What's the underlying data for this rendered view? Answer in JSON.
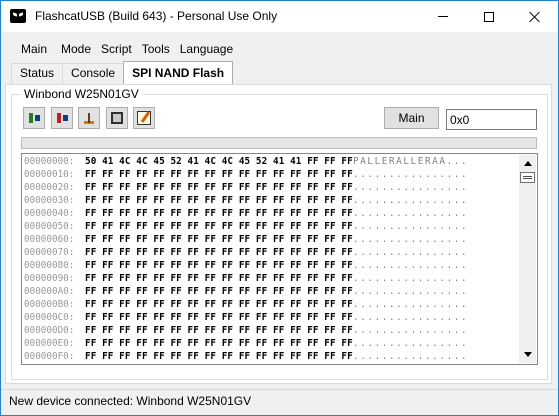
{
  "window": {
    "title": "FlashcatUSB (Build 643) - Personal Use Only",
    "accent": "#1883d7"
  },
  "menubar": {
    "items": [
      "Main",
      "Mode",
      "Script",
      "Tools",
      "Language"
    ]
  },
  "tabs": [
    {
      "label": "Status",
      "active": false
    },
    {
      "label": "Console",
      "active": false
    },
    {
      "label": "SPI NAND Flash",
      "active": true
    }
  ],
  "device": {
    "group_label": "Winbond W25N01GV",
    "toolbar_icons": [
      "read-flash-icon",
      "write-flash-icon",
      "erase-flash-icon",
      "chip-icon",
      "edit-icon"
    ],
    "main_button": "Main",
    "address_value": "0x0"
  },
  "hex": {
    "rows": [
      {
        "addr": "00000000:",
        "bytes": "50 41 4C 4C 45 52 41 4C 4C 45 52 41 41 FF FF FF",
        "ascii": "PALLERALLERAA..."
      },
      {
        "addr": "00000010:",
        "bytes": "FF FF FF FF FF FF FF FF FF FF FF FF FF FF FF FF",
        "ascii": "................"
      },
      {
        "addr": "00000020:",
        "bytes": "FF FF FF FF FF FF FF FF FF FF FF FF FF FF FF FF",
        "ascii": "................"
      },
      {
        "addr": "00000030:",
        "bytes": "FF FF FF FF FF FF FF FF FF FF FF FF FF FF FF FF",
        "ascii": "................"
      },
      {
        "addr": "00000040:",
        "bytes": "FF FF FF FF FF FF FF FF FF FF FF FF FF FF FF FF",
        "ascii": "................"
      },
      {
        "addr": "00000050:",
        "bytes": "FF FF FF FF FF FF FF FF FF FF FF FF FF FF FF FF",
        "ascii": "................"
      },
      {
        "addr": "00000060:",
        "bytes": "FF FF FF FF FF FF FF FF FF FF FF FF FF FF FF FF",
        "ascii": "................"
      },
      {
        "addr": "00000070:",
        "bytes": "FF FF FF FF FF FF FF FF FF FF FF FF FF FF FF FF",
        "ascii": "................"
      },
      {
        "addr": "00000080:",
        "bytes": "FF FF FF FF FF FF FF FF FF FF FF FF FF FF FF FF",
        "ascii": "................"
      },
      {
        "addr": "00000090:",
        "bytes": "FF FF FF FF FF FF FF FF FF FF FF FF FF FF FF FF",
        "ascii": "................"
      },
      {
        "addr": "000000A0:",
        "bytes": "FF FF FF FF FF FF FF FF FF FF FF FF FF FF FF FF",
        "ascii": "................"
      },
      {
        "addr": "000000B0:",
        "bytes": "FF FF FF FF FF FF FF FF FF FF FF FF FF FF FF FF",
        "ascii": "................"
      },
      {
        "addr": "000000C0:",
        "bytes": "FF FF FF FF FF FF FF FF FF FF FF FF FF FF FF FF",
        "ascii": "................"
      },
      {
        "addr": "000000D0:",
        "bytes": "FF FF FF FF FF FF FF FF FF FF FF FF FF FF FF FF",
        "ascii": "................"
      },
      {
        "addr": "000000E0:",
        "bytes": "FF FF FF FF FF FF FF FF FF FF FF FF FF FF FF FF",
        "ascii": "................"
      },
      {
        "addr": "000000F0:",
        "bytes": "FF FF FF FF FF FF FF FF FF FF FF FF FF FF FF FF",
        "ascii": "................"
      }
    ]
  },
  "status": {
    "text": "New device connected: Winbond W25N01GV"
  }
}
